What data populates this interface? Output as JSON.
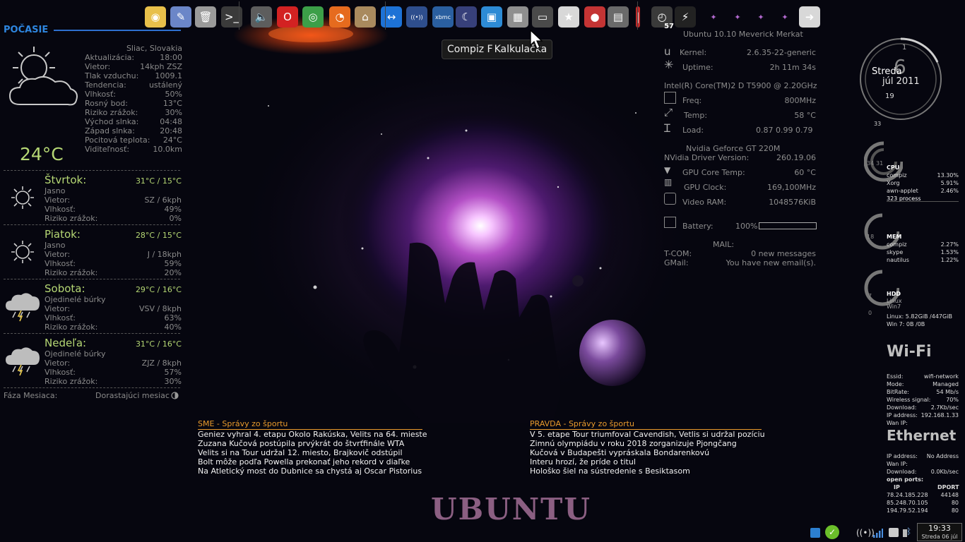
{
  "dock": {
    "items": [
      {
        "name": "dock-gimp",
        "icon": "gimp-icon",
        "color": "#e8c04a",
        "glyph": "◉"
      },
      {
        "name": "dock-notes",
        "icon": "notes-icon",
        "color": "#6b86c8",
        "glyph": "✎"
      },
      {
        "name": "dock-trash",
        "icon": "trash-icon",
        "color": "#9a9a9a",
        "glyph": "🗑"
      },
      {
        "name": "dock-terminal",
        "icon": "terminal-icon",
        "color": "#3a3a3a",
        "glyph": ">_"
      },
      {
        "name": "dock-volume",
        "icon": "volume-icon",
        "color": "#5d5d5d",
        "glyph": "🔈"
      },
      {
        "name": "dock-opera",
        "icon": "opera-icon",
        "color": "#d32222",
        "glyph": "O"
      },
      {
        "name": "dock-chrome",
        "icon": "chrome-icon",
        "color": "#3c9f48",
        "glyph": "◎"
      },
      {
        "name": "dock-firefox",
        "icon": "firefox-icon",
        "color": "#e66b1e",
        "glyph": "◔"
      },
      {
        "name": "dock-home",
        "icon": "home-icon",
        "color": "#a98a5e",
        "glyph": "⌂"
      },
      {
        "name": "dock-teamviewer",
        "icon": "teamviewer-icon",
        "color": "#1d72d6",
        "glyph": "↔"
      },
      {
        "name": "dock-wifi",
        "icon": "wifi-icon",
        "color": "#2e4e8d",
        "glyph": "((•))"
      },
      {
        "name": "dock-xbmc",
        "icon": "xbmc-icon",
        "color": "#2a5fa0",
        "glyph": "xbmc"
      },
      {
        "name": "dock-moon",
        "icon": "moon-icon",
        "color": "#37407a",
        "glyph": "☾"
      },
      {
        "name": "dock-box",
        "icon": "box-icon",
        "color": "#2d8bd5",
        "glyph": "▣"
      },
      {
        "name": "dock-calculator",
        "icon": "calculator-icon",
        "color": "#8f8f8f",
        "glyph": "▦"
      },
      {
        "name": "dock-monitor",
        "icon": "monitor-icon",
        "color": "#4a4a4a",
        "glyph": "▭"
      },
      {
        "name": "dock-disk",
        "icon": "disk-icon",
        "color": "#d8d8d8",
        "glyph": "★"
      },
      {
        "name": "dock-security",
        "icon": "security-icon",
        "color": "#c43434",
        "glyph": "●"
      },
      {
        "name": "dock-display",
        "icon": "display-icon",
        "color": "#6a6a6a",
        "glyph": "▤"
      },
      {
        "name": "dock-bar",
        "icon": "bar-icon",
        "color": "#c02a2a",
        "glyph": "|"
      },
      {
        "name": "dock-speedometer",
        "icon": "speedometer-icon",
        "color": "#3a3a3a",
        "glyph": "◴"
      },
      {
        "name": "dock-power",
        "icon": "power-icon",
        "color": "#222222",
        "glyph": "⚡"
      },
      {
        "name": "dock-star1",
        "icon": "star-icon",
        "color": "transparent",
        "glyph": "✦"
      },
      {
        "name": "dock-star2",
        "icon": "star-icon",
        "color": "transparent",
        "glyph": "✦"
      },
      {
        "name": "dock-star3",
        "icon": "star-icon",
        "color": "transparent",
        "glyph": "✦"
      },
      {
        "name": "dock-star4",
        "icon": "star-icon",
        "color": "transparent",
        "glyph": "✦"
      },
      {
        "name": "dock-logout",
        "icon": "logout-icon",
        "color": "#d8d8d8",
        "glyph": "➜"
      }
    ],
    "speed_badge": "57"
  },
  "tooltip": {
    "back": "Compiz F",
    "front": "Kalkulačka"
  },
  "weather": {
    "title": "POČASIE",
    "current": {
      "rows": [
        {
          "l": "",
          "v": "Sliac, Slovakia"
        },
        {
          "l": "Aktualizácia:",
          "v": "18:00"
        },
        {
          "l": "Vietor:",
          "v": "14kph ZSZ"
        },
        {
          "l": "Tlak vzduchu:",
          "v": "1009.1"
        },
        {
          "l": "Tendencia:",
          "v": "ustálený"
        },
        {
          "l": "Vlhkosť:",
          "v": "50%"
        },
        {
          "l": "Rosný bod:",
          "v": "13°C"
        },
        {
          "l": "Riziko zrážok:",
          "v": "30%"
        },
        {
          "l": "Východ slnka:",
          "v": "04:48"
        },
        {
          "l": "Západ slnka:",
          "v": "20:48"
        },
        {
          "l": "Pocitová teplota:",
          "v": "24°C"
        },
        {
          "l": "Viditeľnosť:",
          "v": "10.0km"
        }
      ],
      "temp": "24°C"
    },
    "days": [
      {
        "day": "Štvrtok:",
        "temp": "31°C / 15°C",
        "cond": "Jasno",
        "wind": "SZ / 6kph",
        "hum": "49%",
        "rain": "0%",
        "icon": "sun"
      },
      {
        "day": "Piatok:",
        "temp": "28°C / 15°C",
        "cond": "Jasno",
        "wind": "J / 18kph",
        "hum": "59%",
        "rain": "20%",
        "icon": "sun"
      },
      {
        "day": "Sobota:",
        "temp": "29°C / 16°C",
        "cond": "Ojedinelé búrky",
        "wind": "VSV / 8kph",
        "hum": "63%",
        "rain": "40%",
        "icon": "storm"
      },
      {
        "day": "Nedeľa:",
        "temp": "31°C / 16°C",
        "cond": "Ojedinelé búrky",
        "wind": "ZJZ / 8kph",
        "hum": "57%",
        "rain": "30%",
        "icon": "storm"
      }
    ],
    "labels": {
      "wind": "Vietor:",
      "hum": "Vlhkosť:",
      "rain": "Riziko zrážok:"
    },
    "moon_label": "Fáza Mesiaca:",
    "moon_value": "Dorastajúci mesiac"
  },
  "system": {
    "os": "Ubuntu 10.10 Meverick Merkat",
    "kernel_label": "Kernel:",
    "kernel": "2.6.35-22-generic",
    "uptime_label": "Uptime:",
    "uptime": "2h 11m 34s",
    "cpu_model": "Intel(R) Core(TM)2 D T5900  @ 2.20GHz",
    "freq_label": "Freq:",
    "freq": "800MHz",
    "temp_label": "Temp:",
    "temp": "58 °C",
    "load_label": "Load:",
    "load": "0.87 0.99 0.79",
    "gpu": "Nvidia Geforce GT 220M",
    "driver_label": "NVidia Driver Version:",
    "driver": "260.19.06",
    "gpu_temp_label": "GPU Core Temp:",
    "gpu_temp": "60 °C",
    "gpu_clock_label": "GPU Clock:",
    "gpu_clock": "169,100MHz",
    "vram_label": "Video RAM:",
    "vram": "1048576KiB",
    "battery_label": "Battery:",
    "battery": "100%",
    "mail_title": "MAIL:",
    "tcom_label": "T-COM:",
    "tcom": "0 new messages",
    "gmail_label": "GMail:",
    "gmail": "You have  new email(s)."
  },
  "news": {
    "sme": {
      "title": "SME - Správy zo športu",
      "items": [
        "Geniez vyhral 4. etapu Okolo Rakúska, Velits na 64. mieste",
        "Zuzana Kučová postúpila prvýkrát do štvrťfinále WTA",
        "Velits si na Tour udržal 12. miesto, Brajkovič odstúpil",
        "Bolt môže podľa Powella prekonať jeho rekord v diaľke",
        "Na Atletický most do Dubnice sa chystá aj Oscar Pistorius"
      ]
    },
    "pravda": {
      "title": "PRAVDA - Správy zo športu",
      "items": [
        "V 5. etape Tour triumfoval Cavendish, Vetlis si udržal pozíciu",
        "Zimnú olympiádu v roku 2018 zorganizuje Pjongčang",
        "Kučová v Budapešti vypráskala Bondarenkovú",
        "Interu hrozí, že príde o titul",
        "Hološko šiel na sústredenie s Besiktasom"
      ]
    }
  },
  "ubuntu_logo": "UBUNTU",
  "clock": {
    "day": "Streda",
    "month_year": "júl 2011",
    "date": "6",
    "top": "1",
    "bottom": "19",
    "corner": "33"
  },
  "cpu": {
    "title": "CPU",
    "ring_a": "34",
    "ring_b": "31",
    "procs": [
      {
        "n": "compiz",
        "v": "13.30%"
      },
      {
        "n": "Xorg",
        "v": "5.91%"
      },
      {
        "n": "awn-applet",
        "v": "2.46%"
      }
    ],
    "count": "323 process"
  },
  "mem": {
    "title": "MEM",
    "ring": "18",
    "procs": [
      {
        "n": "compiz",
        "v": "2.27%"
      },
      {
        "n": "skype",
        "v": "1.53%"
      },
      {
        "n": "nautilus",
        "v": "1.22%"
      }
    ]
  },
  "hdd": {
    "title": "HDD",
    "a": "Linux",
    "b": "Win7",
    "ring_a": "7",
    "ring_b": "0",
    "linux": "Linux: 5.82GiB /447GiB",
    "win": "Win 7: 0B   /0B"
  },
  "wifi": {
    "title": "Wi-Fi",
    "rows": [
      {
        "l": "Essid:",
        "v": "wifi-network"
      },
      {
        "l": "Mode:",
        "v": "Managed"
      },
      {
        "l": "BitRate:",
        "v": "54 Mb/s"
      },
      {
        "l": "Wireless signal:",
        "v": "70%"
      },
      {
        "l": "Download:",
        "v": "2.7Kb/sec"
      },
      {
        "l": "IP address:",
        "v": "192.168.1.33"
      },
      {
        "l": "Wan IP:",
        "v": ""
      }
    ]
  },
  "ethernet": {
    "title": "Ethernet",
    "rows": [
      {
        "l": "IP address:",
        "v": "No Address"
      },
      {
        "l": "Wan IP:",
        "v": ""
      },
      {
        "l": "Download:",
        "v": "0.0Kb/sec"
      }
    ],
    "ports_title": "open ports:",
    "col_ip": "IP",
    "col_port": "DPORT",
    "ports": [
      {
        "ip": "78.24.185.228",
        "p": "44148"
      },
      {
        "ip": "85.248.70.105",
        "p": "80"
      },
      {
        "ip": "194.79.52.194",
        "p": "80"
      }
    ]
  },
  "taskbar": {
    "time": "19:33",
    "date": "Streda 06 júl"
  }
}
